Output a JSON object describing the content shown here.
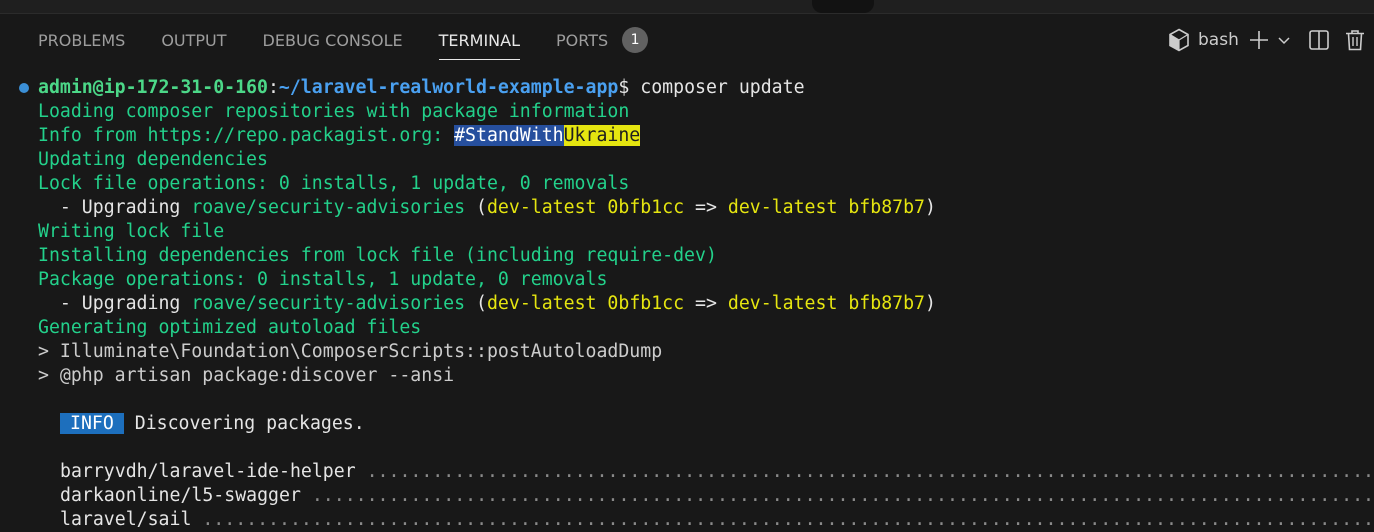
{
  "panel": {
    "tabs": [
      {
        "label": "PROBLEMS"
      },
      {
        "label": "OUTPUT"
      },
      {
        "label": "DEBUG CONSOLE"
      },
      {
        "label": "TERMINAL"
      },
      {
        "label": "PORTS",
        "badge": "1"
      }
    ],
    "active_tab": "TERMINAL",
    "shell_label": "bash",
    "icons": [
      "bash-shell-icon",
      "plus-icon",
      "chevron-down-icon",
      "split-terminal-icon",
      "trash-icon"
    ]
  },
  "terminal": {
    "prompt_user": "admin@ip-172-31-0-160",
    "prompt_sep": ":",
    "prompt_path": "~/laravel-realworld-example-app",
    "prompt_symbol": "$",
    "command": "composer update",
    "lines": {
      "l1": "Loading composer repositories with package information",
      "l2_prefix": "Info from https://repo.packagist.org: ",
      "l2_sel1": "#StandWith",
      "l2_sel2": "Ukraine",
      "l3": "Updating dependencies",
      "l4": "Lock file operations: 0 installs, 1 update, 0 removals",
      "up_dash": "  - Upgrading ",
      "up_pkg": "roave/security-advisories",
      "up_paren_open": " (",
      "up_from": "dev-latest 0bfb1cc",
      "up_arrow": " => ",
      "up_to": "dev-latest bfb87b7",
      "up_paren_close": ")",
      "l6": "Writing lock file",
      "l7": "Installing dependencies from lock file (including require-dev)",
      "l8": "Package operations: 0 installs, 1 update, 0 removals",
      "l10": "Generating optimized autoload files",
      "l11": "> Illuminate\\Foundation\\ComposerScripts::postAutoloadDump",
      "l12": "> @php artisan package:discover --ansi",
      "info_badge": "INFO",
      "info_text": " Discovering packages.",
      "pkg1": "barryvdh/laravel-ide-helper",
      "pkg2": "darkaonline/l5-swagger",
      "pkg3": "laravel/sail",
      "dots": " ..........................................................................................................................."
    }
  },
  "colors": {
    "background": "#181818",
    "prompt_green": "#4cd888",
    "path_blue": "#4aa0f0",
    "output_green": "#23d18b",
    "highlight_yellow": "#e5e510",
    "info_blue": "#1d6fbd"
  }
}
